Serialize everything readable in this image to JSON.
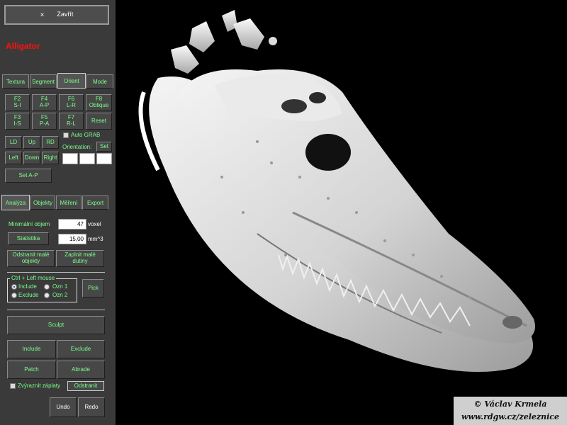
{
  "close_button": {
    "icon": "×",
    "label": "Zavřít"
  },
  "subject_title": "Alligator",
  "top_tabs": [
    "Textura",
    "Segment",
    "Orient",
    "Mode"
  ],
  "orient": {
    "rows": [
      [
        {
          "key": "F2",
          "label": "S-I"
        },
        {
          "key": "F4",
          "label": "A-P"
        },
        {
          "key": "F6",
          "label": "L-R"
        },
        {
          "key": "F8",
          "label": "Oblique"
        }
      ],
      [
        {
          "key": "F3",
          "label": "I-S"
        },
        {
          "key": "F5",
          "label": "P-A"
        },
        {
          "key": "F7",
          "label": "R-L"
        },
        {
          "key": "",
          "label": "Reset"
        }
      ]
    ],
    "ld": "LD",
    "up": "Up",
    "rd": "RD",
    "left": "Left",
    "down": "Down",
    "right": "Right",
    "auto_grab": "Auto GRAB",
    "orientation_label": "Orientation:",
    "set": "Set",
    "set_ap": "Set A-P"
  },
  "analysis_tabs": [
    "Analýza",
    "Objekty",
    "Měření",
    "Export"
  ],
  "analysis": {
    "min_volume_label": "Minimální objem",
    "min_volume_value": "47",
    "min_volume_unit": "voxel",
    "statistics": "Statistika",
    "volume_value": "15,00",
    "volume_unit": "mm^3",
    "remove_small_1": "Odstranit malé",
    "remove_small_2": "objekty",
    "fill_small_1": "Zaplnit malé",
    "fill_small_2": "dutiny",
    "group_title": "Ctrl + Left mouse",
    "include": "Include",
    "exclude": "Exclude",
    "ozn1": "Ozn 1",
    "ozn2": "Ozn 2",
    "pick": "Pick",
    "sculpt": "Sculpt",
    "include_btn": "Include",
    "exclude_btn": "Exclude",
    "patch": "Patch",
    "abrade": "Abrade",
    "highlight_patches": "Zvýraznit záplaty",
    "remove": "Odstranit",
    "undo": "Undo",
    "redo": "Redo"
  },
  "credit": {
    "line1": "© Václav Krmela",
    "line2": "www.rdgw.cz/zeleznice"
  },
  "colors": {
    "panel": "#3a3a3a",
    "label_green": "#7dff8a",
    "title_red": "#ff1010"
  }
}
